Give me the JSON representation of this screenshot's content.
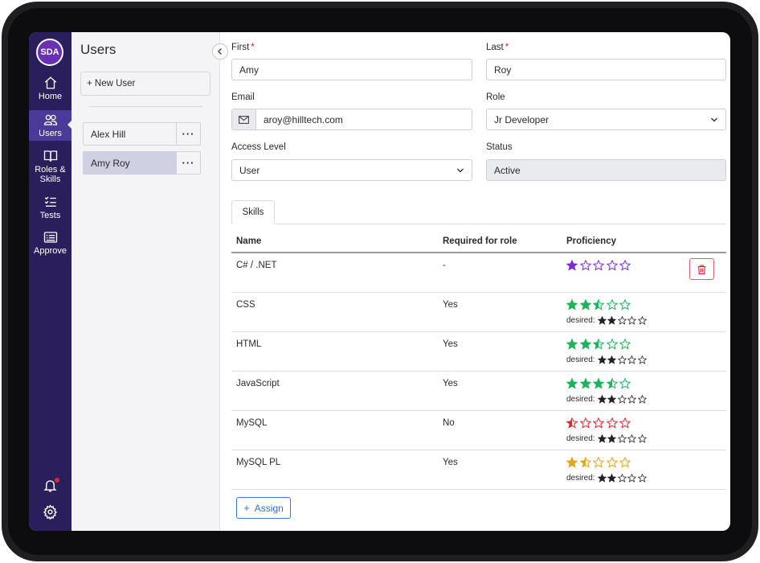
{
  "app": {
    "logo_text": "SDA",
    "accent": "#2a1f5c",
    "active_nav": "#4b3a98"
  },
  "nav": {
    "items": [
      {
        "label": "Home",
        "icon": "home-icon"
      },
      {
        "label": "Users",
        "icon": "users-icon"
      },
      {
        "label": "Roles & Skills",
        "icon": "book-icon"
      },
      {
        "label": "Tests",
        "icon": "list-check-icon"
      },
      {
        "label": "Approve",
        "icon": "id-card-icon"
      }
    ],
    "bottom": [
      {
        "icon": "bell-icon"
      },
      {
        "icon": "gear-icon"
      }
    ]
  },
  "users_panel": {
    "title": "Users",
    "new_user_label": "+ New User",
    "users": [
      {
        "name": "Alex Hill",
        "selected": false,
        "more_label": "···"
      },
      {
        "name": "Amy Roy",
        "selected": true,
        "more_label": "···"
      }
    ]
  },
  "form": {
    "first": {
      "label": "First",
      "required_mark": "*",
      "value": "Amy"
    },
    "last": {
      "label": "Last",
      "required_mark": "*",
      "value": "Roy"
    },
    "email": {
      "label": "Email",
      "value": "aroy@hilltech.com",
      "icon": "envelope-icon"
    },
    "role": {
      "label": "Role",
      "value": "Jr Developer"
    },
    "access_level": {
      "label": "Access Level",
      "value": "User"
    },
    "status": {
      "label": "Status",
      "value": "Active"
    }
  },
  "tabs": [
    {
      "label": "Skills",
      "active": true
    }
  ],
  "skills_table": {
    "headers": {
      "name": "Name",
      "required": "Required for role",
      "proficiency": "Proficiency"
    },
    "desired_label": "desired:",
    "rows": [
      {
        "name": "C# / .NET",
        "required": "-",
        "proficiency": 1,
        "star_color": "#7b2fd1",
        "desired": null,
        "has_delete": true
      },
      {
        "name": "CSS",
        "required": "Yes",
        "proficiency": 2.5,
        "star_color": "#1db35a",
        "desired": 2,
        "has_delete": false
      },
      {
        "name": "HTML",
        "required": "Yes",
        "proficiency": 2.5,
        "star_color": "#1db35a",
        "desired": 2,
        "has_delete": false
      },
      {
        "name": "JavaScript",
        "required": "Yes",
        "proficiency": 3.5,
        "star_color": "#1db35a",
        "desired": 2,
        "has_delete": false
      },
      {
        "name": "MySQL",
        "required": "No",
        "proficiency": 0.5,
        "star_color": "#e0262f",
        "desired": 2,
        "has_delete": false
      },
      {
        "name": "MySQL PL",
        "required": "Yes",
        "proficiency": 1.5,
        "star_color": "#e3a51c",
        "desired": 2,
        "has_delete": false
      }
    ]
  },
  "assign_label": "Assign"
}
